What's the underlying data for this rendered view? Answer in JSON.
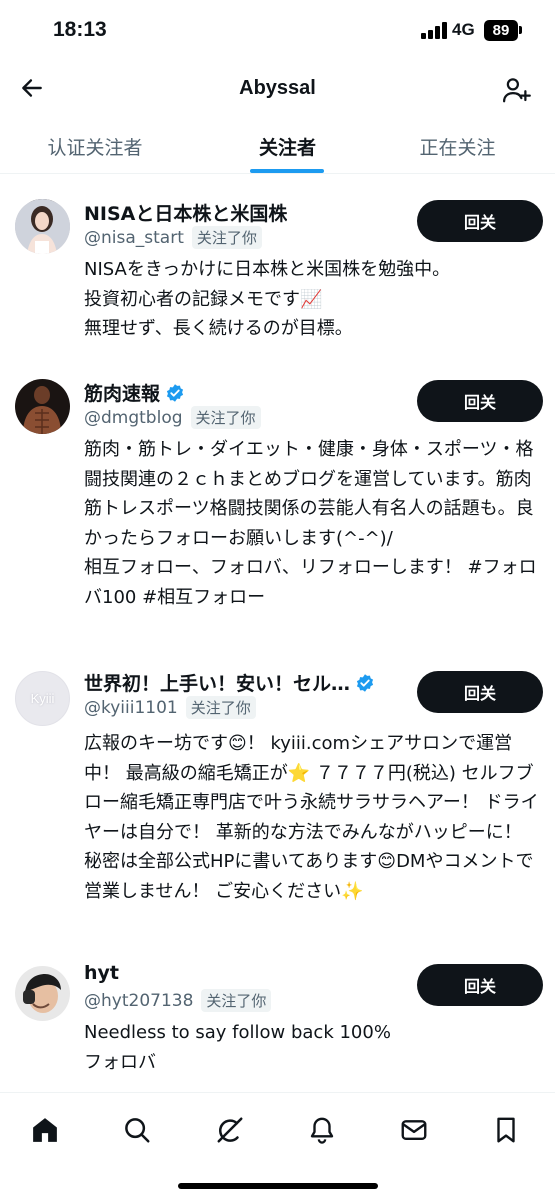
{
  "status_bar": {
    "time": "18:13",
    "network": "4G",
    "battery": "89"
  },
  "header": {
    "title": "Abyssal",
    "back_icon": "arrow-left-icon",
    "add_icon": "add-user-icon"
  },
  "tabs": [
    {
      "label": "认证关注者",
      "active": false
    },
    {
      "label": "关注者",
      "active": true
    },
    {
      "label": "正在关注",
      "active": false
    }
  ],
  "users": [
    {
      "name": "NISAと日本株と米国株",
      "verified": false,
      "handle": "@nisa_start",
      "follows_you": "关注了你",
      "button": "回关",
      "bio": "NISAをきっかけに日本株と米国株を勉強中。\n投資初心者の記録メモです📈\n無理せず、長く続けるのが目標。"
    },
    {
      "name": "筋肉速報",
      "verified": true,
      "handle": "@dmgtblog",
      "follows_you": "关注了你",
      "button": "回关",
      "bio": "筋肉・筋トレ・ダイエット・健康・身体・スポーツ・格闘技関連の２ｃｈまとめブログを運営しています。筋肉筋トレスポーツ格闘技関係の芸能人有名人の話題も。良かったらフォローお願いします(^-^)/\n相互フォロー、フォロバ、リフォローします！ #フォロバ100 #相互フォロー"
    },
    {
      "name": "世界初！上手い！安い！セル…",
      "verified": true,
      "handle": "@kyiii1101",
      "follows_you": "关注了你",
      "button": "回关",
      "avatar_text": "Kyiii",
      "bio": "広報のキー坊です😊！ kyiii.comシェアサロンで運営中！ 最高級の縮毛矯正が⭐️ ７７７７円(税込) セルフブロー縮毛矯正専門店で叶う永続サラサラヘアー！ ドライヤーは自分で！ 革新的な方法でみんながハッピーに！ 秘密は全部公式HPに書いてあります😊DMやコメントで営業しません！ ご安心ください✨"
    },
    {
      "name": "hyt",
      "verified": false,
      "handle": "@hyt207138",
      "follows_you": "关注了你",
      "button": "回关",
      "bio": "Needless to say follow back 100%\nフォロバ"
    }
  ],
  "bottom_nav": [
    {
      "icon": "home-icon",
      "active": true
    },
    {
      "icon": "search-icon",
      "active": false
    },
    {
      "icon": "grok-icon",
      "active": false
    },
    {
      "icon": "bell-icon",
      "active": false
    },
    {
      "icon": "mail-icon",
      "active": false
    },
    {
      "icon": "bookmark-icon",
      "active": false
    }
  ],
  "colors": {
    "accent": "#1d9bf0",
    "text": "#0f1419",
    "muted": "#536471",
    "button": "#0f1419"
  }
}
